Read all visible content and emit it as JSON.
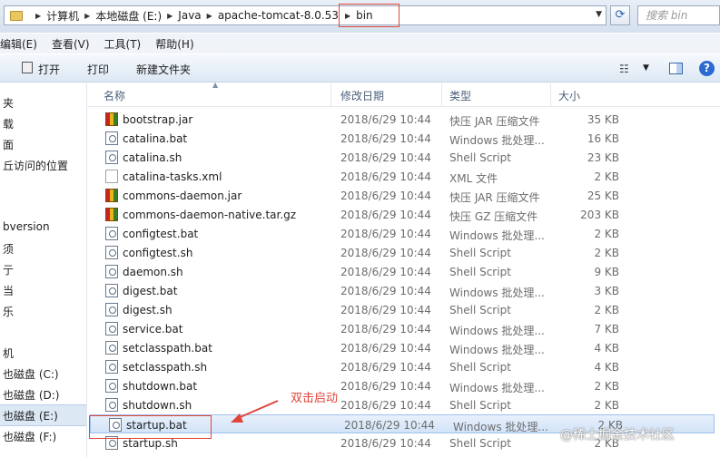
{
  "address": {
    "crumbs": [
      "计算机",
      "本地磁盘 (E:)",
      "Java",
      "apache-tomcat-8.0.53",
      "bin"
    ]
  },
  "search": {
    "placeholder": "搜索 bin"
  },
  "menu": {
    "items": [
      "编辑(E)",
      "查看(V)",
      "工具(T)",
      "帮助(H)"
    ]
  },
  "toolbar": {
    "open": "打开",
    "print": "打印",
    "new_folder": "新建文件夹"
  },
  "nav": {
    "items": [
      "夹",
      "载",
      "面",
      "丘访问的位置",
      "bversion",
      "须",
      "亍",
      "当",
      "乐",
      "机",
      "也磁盘 (C:)",
      "也磁盘 (D:)",
      "也磁盘 (E:)",
      "也磁盘 (F:)"
    ]
  },
  "columns": {
    "name": "名称",
    "date": "修改日期",
    "type": "类型",
    "size": "大小"
  },
  "files": [
    {
      "name": "bootstrap.jar",
      "date": "2018/6/29 10:44",
      "type": "快压 JAR 压缩文件",
      "size": "35 KB",
      "icon": "jar-icon"
    },
    {
      "name": "catalina.bat",
      "date": "2018/6/29 10:44",
      "type": "Windows 批处理...",
      "size": "16 KB",
      "icon": "bat-icon"
    },
    {
      "name": "catalina.sh",
      "date": "2018/6/29 10:44",
      "type": "Shell Script",
      "size": "23 KB",
      "icon": "sh-icon"
    },
    {
      "name": "catalina-tasks.xml",
      "date": "2018/6/29 10:44",
      "type": "XML 文件",
      "size": "2 KB",
      "icon": "xml-icon"
    },
    {
      "name": "commons-daemon.jar",
      "date": "2018/6/29 10:44",
      "type": "快压 JAR 压缩文件",
      "size": "25 KB",
      "icon": "jar-icon"
    },
    {
      "name": "commons-daemon-native.tar.gz",
      "date": "2018/6/29 10:44",
      "type": "快压 GZ 压缩文件",
      "size": "203 KB",
      "icon": "jar-icon"
    },
    {
      "name": "configtest.bat",
      "date": "2018/6/29 10:44",
      "type": "Windows 批处理...",
      "size": "2 KB",
      "icon": "bat-icon"
    },
    {
      "name": "configtest.sh",
      "date": "2018/6/29 10:44",
      "type": "Shell Script",
      "size": "2 KB",
      "icon": "sh-icon"
    },
    {
      "name": "daemon.sh",
      "date": "2018/6/29 10:44",
      "type": "Shell Script",
      "size": "9 KB",
      "icon": "sh-icon"
    },
    {
      "name": "digest.bat",
      "date": "2018/6/29 10:44",
      "type": "Windows 批处理...",
      "size": "3 KB",
      "icon": "bat-icon"
    },
    {
      "name": "digest.sh",
      "date": "2018/6/29 10:44",
      "type": "Shell Script",
      "size": "2 KB",
      "icon": "sh-icon"
    },
    {
      "name": "service.bat",
      "date": "2018/6/29 10:44",
      "type": "Windows 批处理...",
      "size": "7 KB",
      "icon": "bat-icon"
    },
    {
      "name": "setclasspath.bat",
      "date": "2018/6/29 10:44",
      "type": "Windows 批处理...",
      "size": "4 KB",
      "icon": "bat-icon"
    },
    {
      "name": "setclasspath.sh",
      "date": "2018/6/29 10:44",
      "type": "Shell Script",
      "size": "4 KB",
      "icon": "sh-icon"
    },
    {
      "name": "shutdown.bat",
      "date": "2018/6/29 10:44",
      "type": "Windows 批处理...",
      "size": "2 KB",
      "icon": "bat-icon"
    },
    {
      "name": "shutdown.sh",
      "date": "2018/6/29 10:44",
      "type": "Shell Script",
      "size": "2 KB",
      "icon": "sh-icon"
    },
    {
      "name": "startup.bat",
      "date": "2018/6/29 10:44",
      "type": "Windows 批处理...",
      "size": "2 KB",
      "icon": "bat-icon"
    },
    {
      "name": "startup.sh",
      "date": "2018/6/29 10:44",
      "type": "Shell Script",
      "size": "2 KB",
      "icon": "sh-icon"
    }
  ],
  "annotation": {
    "text": "双击启动",
    "color": "#e0453a"
  },
  "watermark": "@稀土掘金技术社区"
}
